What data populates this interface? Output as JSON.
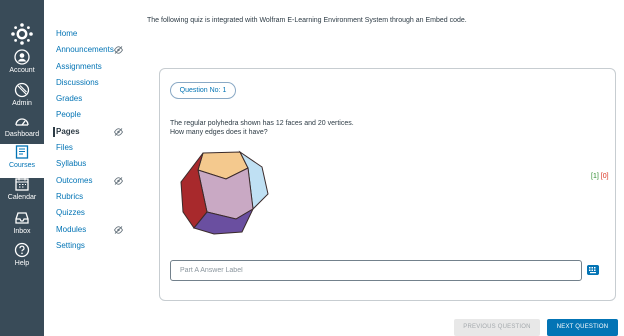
{
  "global_nav": {
    "items": [
      {
        "label": "Account",
        "icon": "account-icon"
      },
      {
        "label": "Admin",
        "icon": "admin-icon"
      },
      {
        "label": "Dashboard",
        "icon": "dashboard-icon"
      },
      {
        "label": "Courses",
        "icon": "courses-icon",
        "active": true
      },
      {
        "label": "Calendar",
        "icon": "calendar-icon"
      },
      {
        "label": "Inbox",
        "icon": "inbox-icon"
      },
      {
        "label": "Help",
        "icon": "help-icon"
      }
    ],
    "collapse_glyph": "|←",
    "colors": {
      "background": "#394b58",
      "active": "#0374b5"
    }
  },
  "course_nav": {
    "items": [
      {
        "label": "Home"
      },
      {
        "label": "Announcements",
        "hidden_icon": true
      },
      {
        "label": "Assignments"
      },
      {
        "label": "Discussions"
      },
      {
        "label": "Grades"
      },
      {
        "label": "People"
      },
      {
        "label": "Pages",
        "hidden_icon": true,
        "active": true
      },
      {
        "label": "Files"
      },
      {
        "label": "Syllabus"
      },
      {
        "label": "Outcomes",
        "hidden_icon": true
      },
      {
        "label": "Rubrics"
      },
      {
        "label": "Quizzes"
      },
      {
        "label": "Modules",
        "hidden_icon": true
      },
      {
        "label": "Settings"
      }
    ]
  },
  "main": {
    "intro": "The following quiz is integrated with Wolfram E-Learning Environment System through an Embed code.",
    "question_number": "Question No: 1",
    "question_line1": "The regular polyhedra shown has 12 faces and 20 vertices.",
    "question_line2": "How many edges does it have?",
    "score_correct": "[1]",
    "score_incorrect": "[0]",
    "answer_placeholder": "Part A Answer Label",
    "answer_value": "",
    "prev_button": "PREVIOUS QUESTION",
    "next_button": "NEXT QUESTION"
  }
}
